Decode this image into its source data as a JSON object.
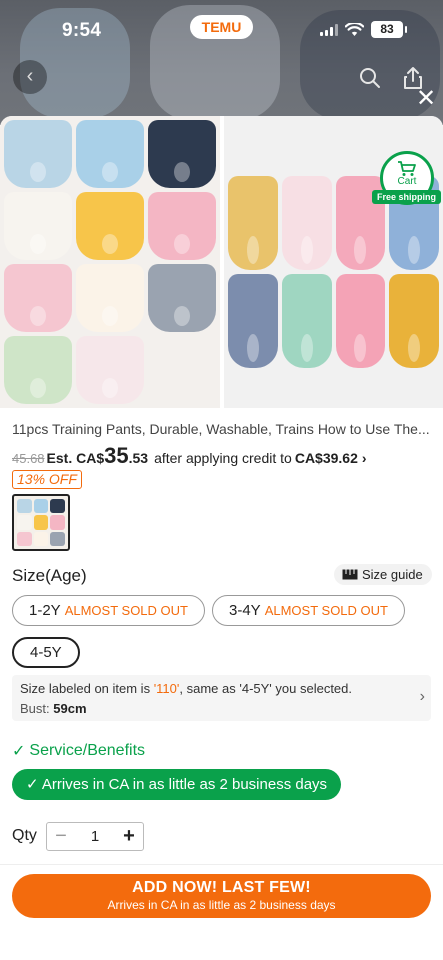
{
  "status_bar": {
    "time": "9:54",
    "app_badge": "TEMU",
    "battery": "83"
  },
  "nav": {
    "back_icon": "chevron-left-icon",
    "search_icon": "search-icon",
    "share_icon": "share-icon",
    "close_icon": "close-icon"
  },
  "gallery": {
    "left_colors": [
      "#b9d5e6",
      "#a9d0e8",
      "#2d3a4f",
      "#f7f4ef",
      "#f7c54a",
      "#f4b6c4",
      "#f5c6d0",
      "#fbf3e8",
      "#9aa3b0",
      "#cfe5c8",
      "#f6e7ea"
    ],
    "right_colors": [
      "#e9b23a",
      "#f4a3b6",
      "#9fd6c1",
      "#7c8dad",
      "#8fb1d9",
      "#f4a9bb",
      "#f7dfe4",
      "#e9c36b"
    ],
    "cart_label": "Cart",
    "free_shipping": "Free shipping"
  },
  "product": {
    "title": "11pcs Training Pants, Durable, Washable, Trains How to Use The...",
    "old_price": "45.68",
    "est_label": "Est. CA$",
    "price_whole": "35",
    "price_cents": ".53",
    "credit_text": "after applying credit to",
    "credit_amount": "CA$39.62",
    "discount": "13% OFF"
  },
  "size": {
    "label": "Size(Age)",
    "guide": "Size guide",
    "options": [
      {
        "size": "1-2Y",
        "status": "ALMOST SOLD OUT"
      },
      {
        "size": "3-4Y",
        "status": "ALMOST SOLD OUT"
      },
      {
        "size": "4-5Y",
        "status": ""
      }
    ],
    "info_prefix": "Size labeled on item is ",
    "info_code": "'110'",
    "info_suffix": ", same as '4-5Y' you selected.",
    "bust_label": "Bust:",
    "bust_value": "59cm"
  },
  "service": {
    "title": "Service/Benefits",
    "arrives": "Arrives in CA in as little as 2 business days"
  },
  "qty": {
    "label": "Qty",
    "value": "1"
  },
  "cta": {
    "line1": "ADD NOW! LAST FEW!",
    "line2": "Arrives in CA in as little as 2 business days"
  },
  "colors": {
    "accent": "#f36b0d",
    "green": "#0aa14b"
  }
}
